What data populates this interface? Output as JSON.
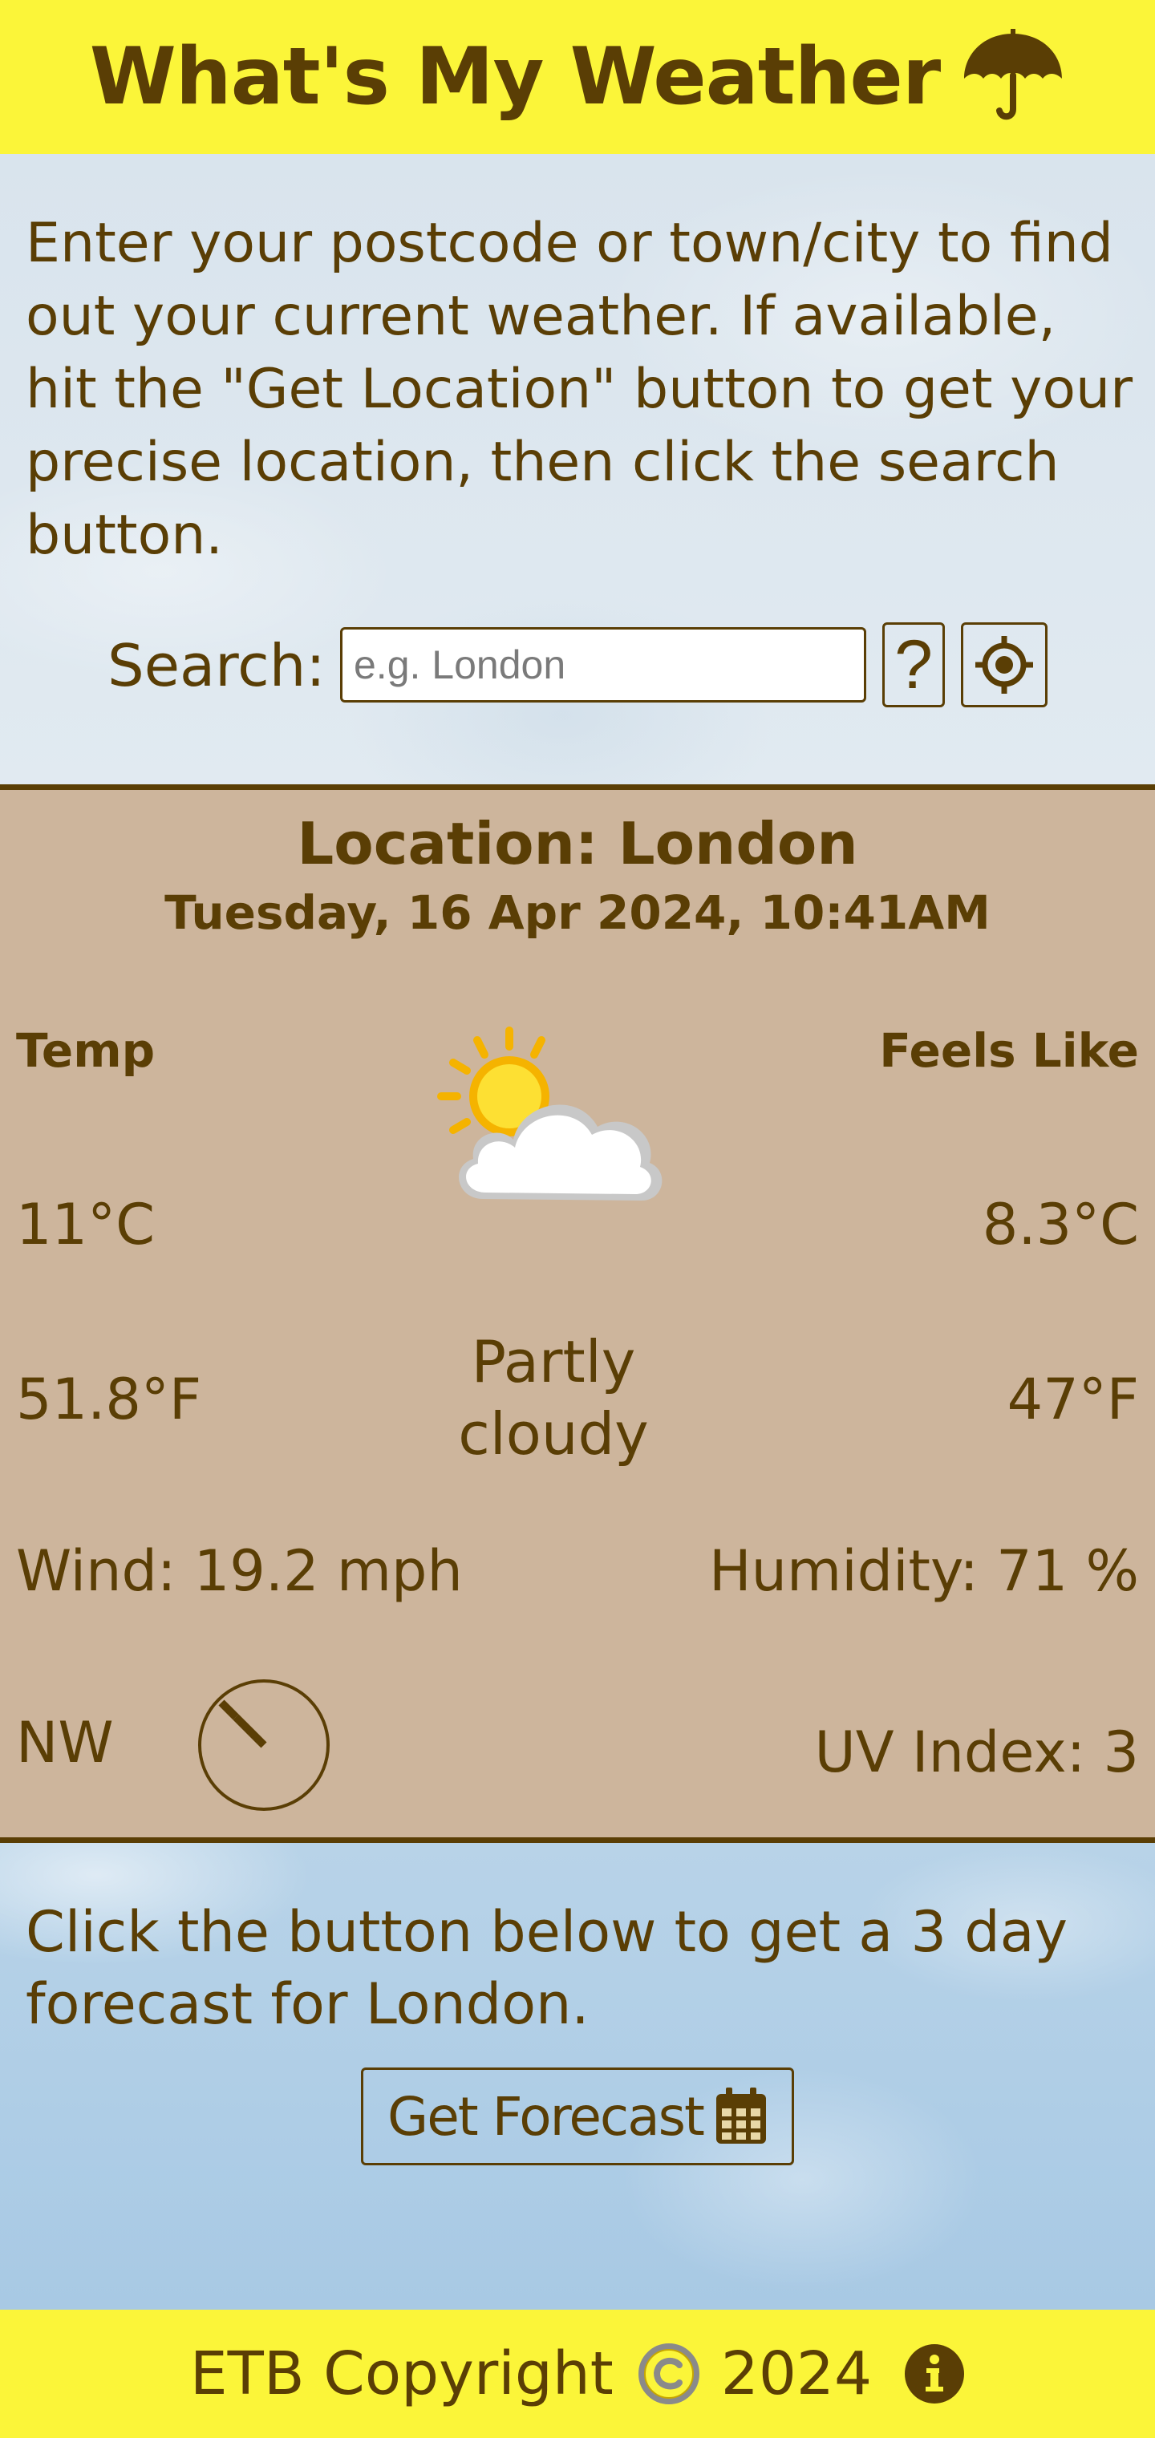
{
  "header": {
    "title": "What's My Weather",
    "icon": "umbrella-icon"
  },
  "intro": {
    "text": "Enter your postcode or town/city to find out your current weather. If available, hit the \"Get Location\" button to get your precise location, then click the search button."
  },
  "search": {
    "label": "Search:",
    "placeholder": "e.g. London",
    "value": "",
    "help_label": "?",
    "location_icon": "crosshair-icon"
  },
  "weather": {
    "location": "Location: London",
    "datetime": "Tuesday, 16 Apr 2024, 10:41AM",
    "temp_label": "Temp",
    "feels_label": "Feels Like",
    "temp_c": "11°C",
    "temp_f": "51.8°F",
    "feels_c": "8.3°C",
    "feels_f": "47°F",
    "condition": "Partly cloudy",
    "condition_icon": "partly-cloudy-icon",
    "wind": "Wind: 19.2 mph",
    "humidity": "Humidity: 71 %",
    "wind_dir": "NW",
    "uv": "UV Index: 3"
  },
  "forecast": {
    "text": "Click the button below to get a 3 day forecast for London.",
    "button_label": "Get Forecast",
    "button_icon": "calendar-icon"
  },
  "footer": {
    "text_before": "ETB Copyright",
    "year": "2024",
    "copyright_icon": "copyright-icon",
    "info_icon": "info-icon"
  },
  "colors": {
    "primary_text": "#5a3e05",
    "header_bg": "#fbf539",
    "weather_bg": "#cdb59c"
  }
}
